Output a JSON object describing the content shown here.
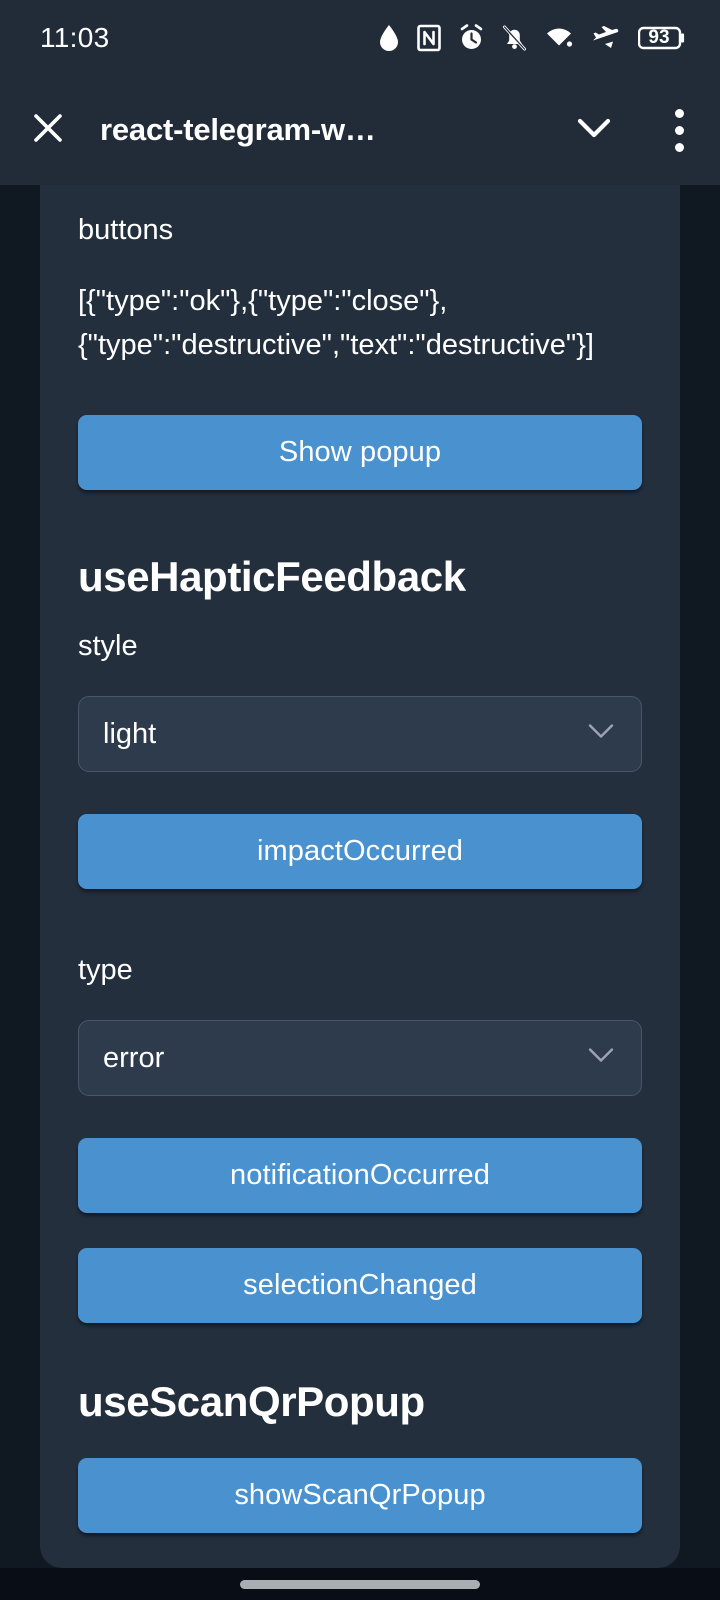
{
  "status_bar": {
    "time": "11:03",
    "battery_level": "93",
    "icons": [
      "water-drop-icon",
      "nfc-icon",
      "alarm-clock-icon",
      "bell-muted-icon",
      "wifi-icon",
      "airplane-mode-icon",
      "battery-icon"
    ]
  },
  "header": {
    "close_label": "close-icon",
    "title": "react-telegram-w…",
    "collapse_label": "chevron-down-icon",
    "menu_label": "more-options-icon"
  },
  "main": {
    "buttons_field": {
      "label": "buttons",
      "value": "[{\"type\":\"ok\"},{\"type\":\"close\"},{\"type\":\"destructive\",\"text\":\"destructive\"}]"
    },
    "show_popup_button": "Show popup",
    "haptic_section": {
      "title": "useHapticFeedback",
      "style_label": "style",
      "style_value": "light",
      "impact_button": "impactOccurred",
      "type_label": "type",
      "type_value": "error",
      "notification_button": "notificationOccurred",
      "selection_button": "selectionChanged"
    },
    "scanqr_section": {
      "title": "useScanQrPopup",
      "show_button": "showScanQrPopup"
    }
  },
  "colors": {
    "accent_blue": "#4a92cf",
    "panel_bg": "#242f3e",
    "page_bg": "#101922",
    "header_bg": "#222b38",
    "select_bg": "#2e3b4d",
    "navbar_bg": "#080d16"
  }
}
